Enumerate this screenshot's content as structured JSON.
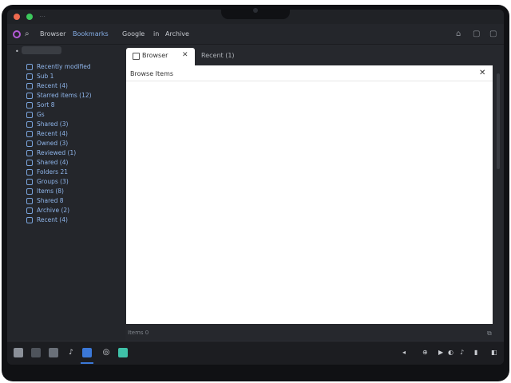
{
  "window": {
    "mini_title": "⋯"
  },
  "menubar": {
    "items": [
      "Browser",
      "Bookmarks",
      "Google",
      "in",
      "Archive"
    ]
  },
  "sidebar": {
    "header": "⋯⋯⋯",
    "items": [
      {
        "label": "Recently modified"
      },
      {
        "label": "Sub 1"
      },
      {
        "label": "Recent (4)"
      },
      {
        "label": "Starred items (12)"
      },
      {
        "label": "Sort 8"
      },
      {
        "label": "Gs"
      },
      {
        "label": "Shared (3)"
      },
      {
        "label": "Recent (4)"
      },
      {
        "label": "Owned (3)"
      },
      {
        "label": "Reviewed (1)"
      },
      {
        "label": "Shared (4)"
      },
      {
        "label": "Folders 21"
      },
      {
        "label": "Groups (3)"
      },
      {
        "label": "Items (8)"
      },
      {
        "label": "Shared 8"
      },
      {
        "label": "Archive (2)"
      },
      {
        "label": "Recent (4)"
      }
    ]
  },
  "tabs": [
    {
      "label": "Browser",
      "active": true
    },
    {
      "label": "Recent (1)",
      "active": false
    }
  ],
  "panel": {
    "title": "Browse Items"
  },
  "status": {
    "text": "Items 0"
  },
  "dock": {
    "tray": [
      "◂",
      "⊕",
      "▶",
      "◐",
      "♪",
      "▮",
      "◧"
    ]
  },
  "colors": {
    "accent": "#3b78d8",
    "link": "#8fb5ea",
    "background": "#202226",
    "panel": "#ffffff"
  }
}
